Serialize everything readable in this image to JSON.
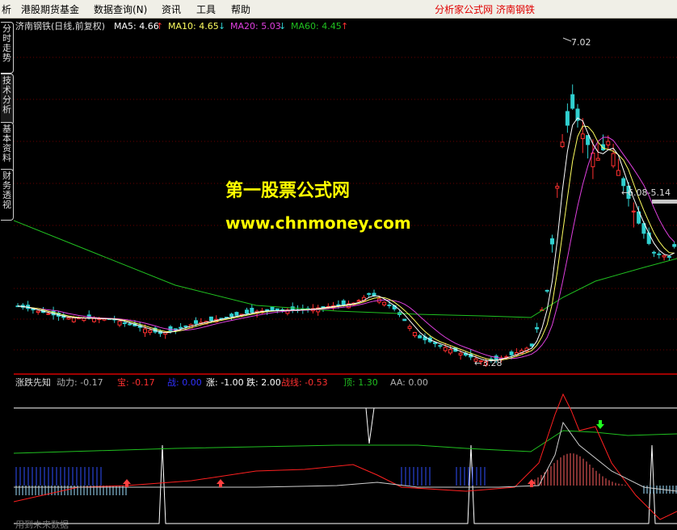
{
  "menubar": {
    "items": [
      "析",
      "港股期货基金",
      "数据查询(N)",
      "资讯",
      "工具",
      "帮助"
    ],
    "title": "分析家公式网  济南钢铁"
  },
  "sidebar": {
    "tabs": [
      "分时走势",
      "技术分析",
      "基本资料",
      "财务透视"
    ]
  },
  "main_chart": {
    "header": {
      "stock": "济南钢铁(日线,前复权)",
      "ma5": "MA5: 4.66",
      "ma10": "MA10: 4.65",
      "ma20": "MA20: 5.03",
      "ma60": "MA60: 4.45",
      "ma5_arrow": "↑",
      "ma10_arrow": "↓",
      "ma20_arrow": "↓",
      "ma60_arrow": "↑"
    },
    "annotations": {
      "high": "7.02",
      "low": "3.28",
      "range": "6.08-5.14"
    },
    "watermark": {
      "title": "第一股票公式网",
      "url": "www.chnmoney.com"
    },
    "colors": {
      "up": "#ff3030",
      "down": "#30d0d0",
      "ma5": "#ffffff",
      "ma10": "#ffff60",
      "ma20": "#e040e0",
      "ma60": "#20c020",
      "grid": "#7a0000"
    }
  },
  "sub_chart": {
    "header": {
      "name": "涨跌先知",
      "dongli": "动力: -0.17",
      "bao": "宝: -0.17",
      "zhan": "战: 0.00",
      "zhang": "涨: -1.00",
      "die": "跌: 2.00",
      "zhanxian": "战线: -0.53",
      "ding": "顶: 1.30",
      "aa": "AA: 0.00"
    },
    "footer": "用到未来数据"
  }
}
